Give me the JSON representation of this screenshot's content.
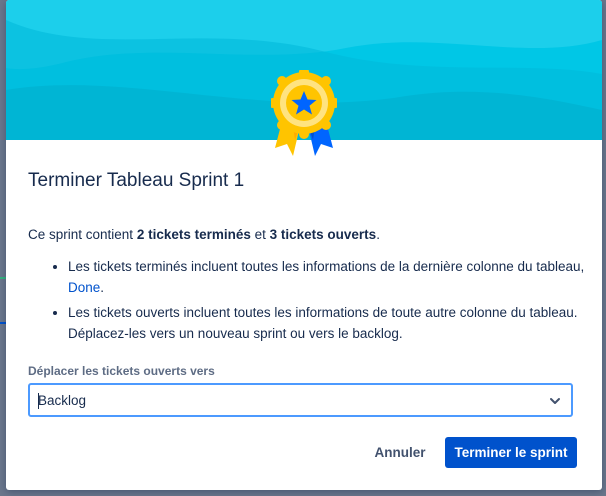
{
  "dialog": {
    "title": "Terminer Tableau Sprint 1",
    "summary": {
      "prefix": "Ce sprint contient ",
      "done_count_text": "2 tickets terminés",
      "middle": " et ",
      "open_count_text": "3 tickets ouverts",
      "suffix": "."
    },
    "bullets": [
      {
        "text_before_link": "Les tickets terminés incluent toutes les informations de la dernière colonne du tableau, ",
        "link": "Done",
        "text_after_link": "."
      },
      {
        "text": "Les tickets ouverts incluent toutes les informations de toute autre colonne du tableau. Déplacez-les vers un nouveau sprint ou vers le backlog."
      }
    ],
    "move_field": {
      "label": "Déplacer les tickets ouverts vers",
      "value": "Backlog"
    },
    "buttons": {
      "cancel": "Annuler",
      "confirm": "Terminer le sprint"
    }
  },
  "icons": {
    "badge": "award-ribbon-star-icon",
    "chevron": "chevron-down-icon"
  },
  "colors": {
    "hero": "#00c7e6",
    "primary": "#0052cc",
    "link": "#0052cc",
    "focus_border": "#4c9aff",
    "ribbon_gold": "#ffc400",
    "ribbon_blue": "#0065ff"
  }
}
